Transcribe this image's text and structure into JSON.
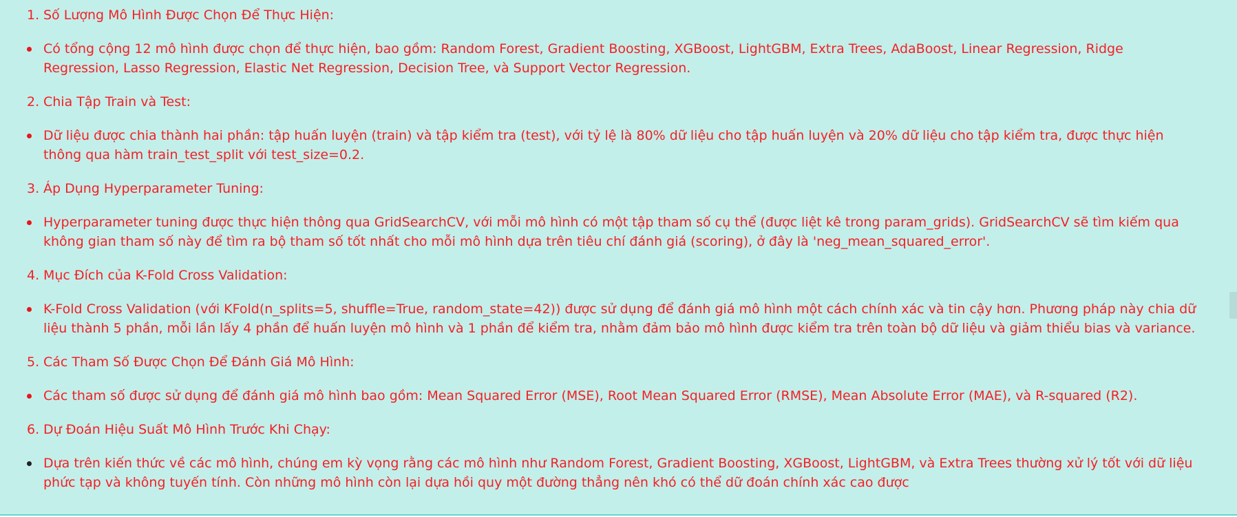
{
  "sections": [
    {
      "number": "1.",
      "title": "Số Lượng Mô Hình Được Chọn Để Thực Hiện:",
      "bullet": "Có tổng cộng 12 mô hình được chọn để thực hiện, bao gồm: Random Forest, Gradient Boosting, XGBoost, LightGBM, Extra Trees, AdaBoost, Linear Regression, Ridge Regression, Lasso Regression, Elastic Net Regression, Decision Tree, và Support Vector Regression."
    },
    {
      "number": "2.",
      "title": "Chia Tập Train và Test:",
      "bullet": "Dữ liệu được chia thành hai phần: tập huấn luyện (train) và tập kiểm tra (test), với tỷ lệ là 80% dữ liệu cho tập huấn luyện và 20% dữ liệu cho tập kiểm tra, được thực hiện thông qua hàm train_test_split với test_size=0.2."
    },
    {
      "number": "3.",
      "title": "Áp Dụng Hyperparameter Tuning:",
      "bullet": "Hyperparameter tuning được thực hiện thông qua GridSearchCV, với mỗi mô hình có một tập tham số cụ thể (được liệt kê trong param_grids). GridSearchCV sẽ tìm kiếm qua không gian tham số này để tìm ra bộ tham số tốt nhất cho mỗi mô hình dựa trên tiêu chí đánh giá (scoring), ở đây là 'neg_mean_squared_error'."
    },
    {
      "number": "4.",
      "title": "Mục Đích của K-Fold Cross Validation:",
      "bullet": "K-Fold Cross Validation (với KFold(n_splits=5, shuffle=True, random_state=42)) được sử dụng để đánh giá mô hình một cách chính xác và tin cậy hơn. Phương pháp này chia dữ liệu thành 5 phần, mỗi lần lấy 4 phần để huấn luyện mô hình và 1 phần để kiểm tra, nhằm đảm bảo mô hình được kiểm tra trên toàn bộ dữ liệu và giảm thiểu bias và variance."
    },
    {
      "number": "5.",
      "title": "Các Tham Số Được Chọn Để Đánh Giá Mô Hình:",
      "bullet": "Các tham số được sử dụng để đánh giá mô hình bao gồm: Mean Squared Error (MSE), Root Mean Squared Error (RMSE), Mean Absolute Error (MAE), và R-squared (R2)."
    },
    {
      "number": "6.",
      "title": "Dự Đoán Hiệu Suất Mô Hình Trước Khi Chạy:",
      "bullet": "Dựa trên kiến thức về các mô hình, chúng em kỳ vọng rằng các mô hình như Random Forest, Gradient Boosting, XGBoost, LightGBM, và Extra Trees thường xử lý tốt với dữ liệu phức tạp và không tuyến tính. Còn những mô hình còn lại dựa hồi quy một đường thẳng nên khó có thể dữ đoán chính xác cao được"
    }
  ],
  "colors": {
    "background": "#c3efea",
    "text": "#f51f24",
    "bottom_border": "#5fd7d0"
  }
}
